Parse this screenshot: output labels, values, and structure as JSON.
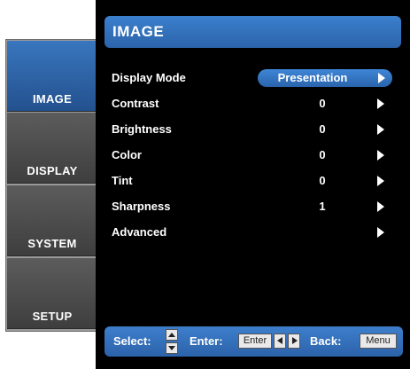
{
  "tabs": [
    {
      "label": "IMAGE",
      "active": true
    },
    {
      "label": "DISPLAY",
      "active": false
    },
    {
      "label": "SYSTEM",
      "active": false
    },
    {
      "label": "SETUP",
      "active": false
    }
  ],
  "panel": {
    "title": "IMAGE",
    "rows": [
      {
        "label": "Display Mode",
        "value": "Presentation"
      },
      {
        "label": "Contrast",
        "value": "0"
      },
      {
        "label": "Brightness",
        "value": "0"
      },
      {
        "label": "Color",
        "value": "0"
      },
      {
        "label": "Tint",
        "value": "0"
      },
      {
        "label": "Sharpness",
        "value": "1"
      },
      {
        "label": "Advanced",
        "value": ""
      }
    ]
  },
  "footer": {
    "select_label": "Select:",
    "enter_label": "Enter:",
    "enter_key": "Enter",
    "back_label": "Back:",
    "menu_key": "Menu"
  },
  "colors": {
    "accent": "#2c64ab",
    "active_tab": "#2f63a5",
    "panel_bg": "#000000",
    "inactive_tab": "#4a4a4a"
  },
  "icons": {
    "row_arrow": "right-arrow-icon",
    "updown": "up-down-keys-icon",
    "leftright": "left-right-keys-icon"
  }
}
